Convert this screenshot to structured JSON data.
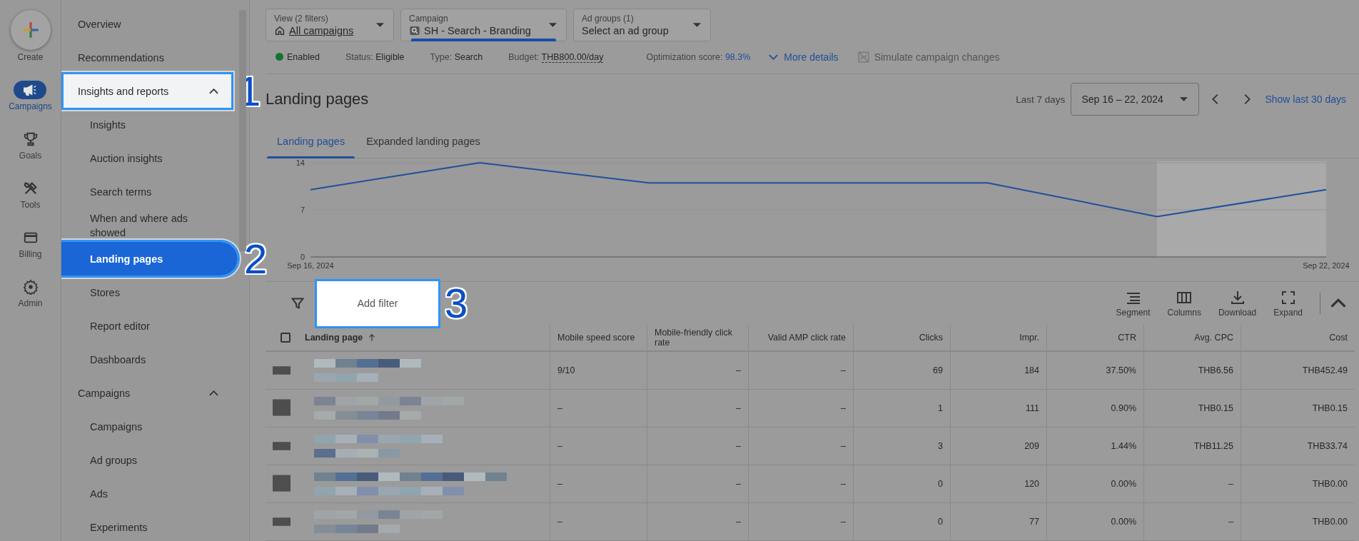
{
  "rail": {
    "create": {
      "label": "Create"
    },
    "items": [
      {
        "label": "Campaigns",
        "kind": "megaphone",
        "selected": true
      },
      {
        "label": "Goals",
        "kind": "trophy",
        "selected": false
      },
      {
        "label": "Tools",
        "kind": "tools",
        "selected": false
      },
      {
        "label": "Billing",
        "kind": "card",
        "selected": false
      },
      {
        "label": "Admin",
        "kind": "gear",
        "selected": false
      }
    ]
  },
  "nav": {
    "items": [
      {
        "label": "Overview",
        "selected": false
      },
      {
        "label": "Recommendations",
        "selected": false
      },
      {
        "label": "Insights and reports",
        "selected": false,
        "expanded": true,
        "callout": "1",
        "children": [
          {
            "label": "Insights",
            "selected": false
          },
          {
            "label": "Auction insights",
            "selected": false
          },
          {
            "label": "Search terms",
            "selected": false
          },
          {
            "label": "When and where ads showed",
            "selected": false
          },
          {
            "label": "Landing pages",
            "selected": true,
            "callout": "2"
          },
          {
            "label": "Stores",
            "selected": false
          },
          {
            "label": "Report editor",
            "selected": false
          },
          {
            "label": "Dashboards",
            "selected": false
          }
        ]
      },
      {
        "label": "Campaigns",
        "selected": false,
        "expanded": true,
        "children": [
          {
            "label": "Campaigns",
            "selected": false
          },
          {
            "label": "Ad groups",
            "selected": false
          },
          {
            "label": "Ads",
            "selected": false
          },
          {
            "label": "Experiments",
            "selected": false
          }
        ]
      }
    ]
  },
  "filters": [
    {
      "label": "View (2 filters)",
      "value": "All campaigns",
      "kind": "home",
      "selected": false
    },
    {
      "label": "Campaign",
      "value": "SH - Search - Branding",
      "kind": "search",
      "selected": true
    },
    {
      "label": "Ad groups (1)",
      "value": "Select an ad group",
      "kind": "plain",
      "selected": false
    }
  ],
  "status_bar": {
    "state": {
      "label": "Enabled",
      "color": "#137333"
    },
    "status": {
      "label": "Status:",
      "value": "Eligible"
    },
    "type": {
      "label": "Type:",
      "value": "Search"
    },
    "budget": {
      "label": "Budget:",
      "value": "THB800.00/day"
    },
    "optimization": {
      "label": "Optimization score:",
      "value": "98.3%"
    },
    "more_details": "More details",
    "simulate": {
      "label": "Simulate campaign changes",
      "disabled": true
    }
  },
  "header": {
    "title": "Landing pages",
    "range_label": "Last 7 days",
    "date_range": "Sep 16 – 22, 2024",
    "show_more": "Show last 30 days"
  },
  "tabs": [
    {
      "label": "Landing pages",
      "selected": true
    },
    {
      "label": "Expanded landing pages",
      "selected": false
    }
  ],
  "chart": {
    "chart_data": {
      "type": "line",
      "categories": [
        "Sep 16, 2024",
        null,
        null,
        null,
        null,
        null,
        "Sep 22, 2024"
      ],
      "series": [
        {
          "color": "#1e4f9c",
          "values": [
            10,
            14,
            11,
            11,
            11,
            6,
            10
          ]
        }
      ],
      "ylim": [
        0,
        14
      ],
      "yticks": [
        0,
        7,
        14
      ]
    },
    "hover_band": {
      "shown": true
    }
  },
  "toolbar": {
    "filter": {
      "label": "Add filter",
      "callout": "3"
    },
    "tools": [
      {
        "label": "Segment",
        "kind": "segment"
      },
      {
        "label": "Columns",
        "kind": "columns"
      },
      {
        "label": "Download",
        "kind": "download"
      },
      {
        "label": "Expand",
        "kind": "expand"
      }
    ]
  },
  "table": {
    "select_all": {
      "checked": false
    },
    "columns": [
      {
        "label": "Landing page",
        "sorted": true
      },
      {
        "label": "Mobile speed score",
        "sorted": false
      },
      {
        "label": "Mobile-friendly click rate",
        "sorted": false
      },
      {
        "label": "Valid AMP click rate",
        "sorted": false
      },
      {
        "label": "Clicks",
        "sorted": false
      },
      {
        "label": "Impr.",
        "sorted": false
      },
      {
        "label": "CTR",
        "sorted": false
      },
      {
        "label": "Avg. CPC",
        "sorted": false
      },
      {
        "label": "Cost",
        "sorted": false
      }
    ],
    "rows": [
      {
        "cells": [
          "",
          "9/10",
          "–",
          "–",
          "69",
          "184",
          "37.50%",
          "THB6.56",
          "THB452.49"
        ]
      },
      {
        "cells": [
          "",
          "–",
          "–",
          "–",
          "1",
          "111",
          "0.90%",
          "THB0.15",
          "THB0.15"
        ]
      },
      {
        "cells": [
          "",
          "–",
          "–",
          "–",
          "3",
          "209",
          "1.44%",
          "THB11.25",
          "THB33.74"
        ]
      },
      {
        "cells": [
          "",
          "–",
          "–",
          "–",
          "0",
          "120",
          "0.00%",
          "–",
          "THB0.00"
        ]
      },
      {
        "cells": [
          "",
          "–",
          "–",
          "–",
          "0",
          "77",
          "0.00%",
          "–",
          "THB0.00"
        ]
      }
    ]
  }
}
